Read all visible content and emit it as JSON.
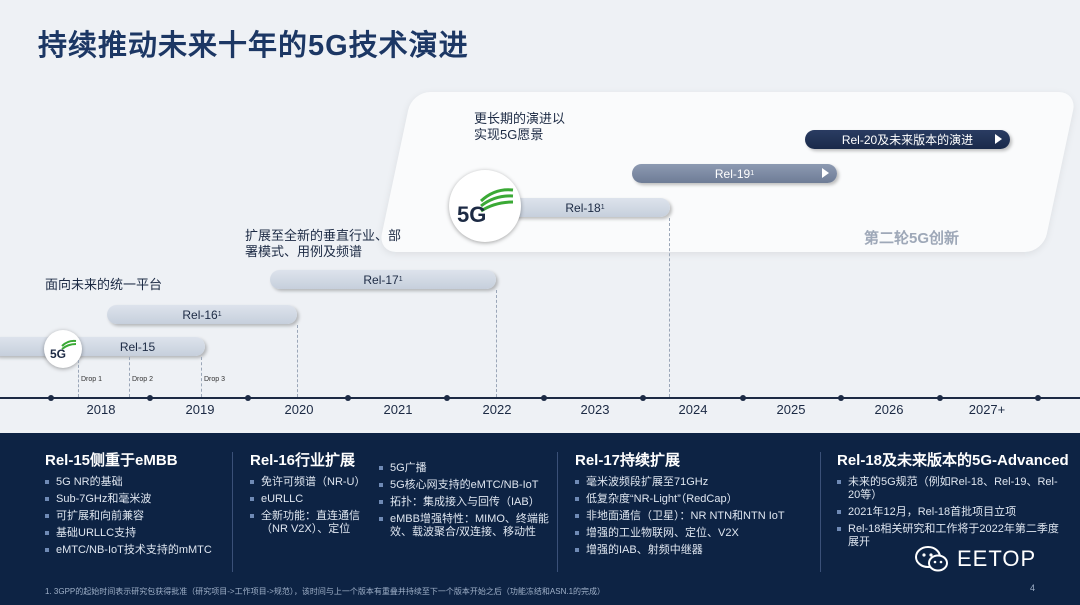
{
  "title": "持续推动未来十年的5G技术演进",
  "notes": {
    "unified": "面向未来的统一平台",
    "vertical": "扩展至全新的垂直行业、部署模式、用例及频谱",
    "long_term": "更长期的演进以实现5G愿景",
    "second_wave": "第二轮5G创新"
  },
  "releases": [
    {
      "label": "Rel-15",
      "sup": ""
    },
    {
      "label": "Rel-16",
      "sup": "1"
    },
    {
      "label": "Rel-17",
      "sup": "1"
    },
    {
      "label": "Rel-18",
      "sup": "1"
    },
    {
      "label": "Rel-19",
      "sup": "1"
    },
    {
      "label": "Rel-20及未来版本的演进",
      "sup": ""
    }
  ],
  "drops": [
    "Drop 1",
    "Drop 2",
    "Drop 3"
  ],
  "years": [
    "2018",
    "2019",
    "2020",
    "2021",
    "2022",
    "2023",
    "2024",
    "2025",
    "2026",
    "2027+"
  ],
  "columns": [
    {
      "heading": "Rel-15侧重于eMBB",
      "items": [
        "5G NR的基础",
        "Sub-7GHz和毫米波",
        "可扩展和向前兼容",
        "基础URLLC支持",
        "eMTC/NB-IoT技术支持的mMTC"
      ]
    },
    {
      "heading": "Rel-16行业扩展",
      "items": [
        "免许可频谱（NR-U）",
        "eURLLC",
        "全新功能：直连通信（NR V2X）、定位"
      ]
    },
    {
      "heading": "",
      "items": [
        "5G广播",
        "5G核心网支持的eMTC/NB-IoT",
        "拓扑：集成接入与回传（IAB）",
        "eMBB增强特性：MIMO、终端能效、载波聚合/双连接、移动性"
      ]
    },
    {
      "heading": "Rel-17持续扩展",
      "items": [
        "毫米波频段扩展至71GHz",
        "低复杂度“NR-Light”（RedCap）",
        "非地面通信（卫星）：NR NTN和NTN IoT",
        "增强的工业物联网、定位、V2X",
        "增强的IAB、射频中继器"
      ]
    },
    {
      "heading": "Rel-18及未来版本的5G-Advanced",
      "items": [
        "未来的5G规范（例如Rel-18、Rel-19、Rel-20等）",
        "2021年12月，Rel-18首批项目立项",
        "Rel-18相关研究和工作将于2022年第二季度展开"
      ]
    }
  ],
  "footnote": "1. 3GPP的起始时间表示研究包获得批准（研究项目->工作项目->规范），该时间与上一个版本有重叠并持续至下一个版本开始之后（功能冻结和ASN.1的完成）",
  "page_number": "4",
  "watermark": "EETOP",
  "badge_text": "5G",
  "colors": {
    "navy": "#0d2344",
    "title": "#1c3764",
    "logo_green": "#3aa935"
  }
}
